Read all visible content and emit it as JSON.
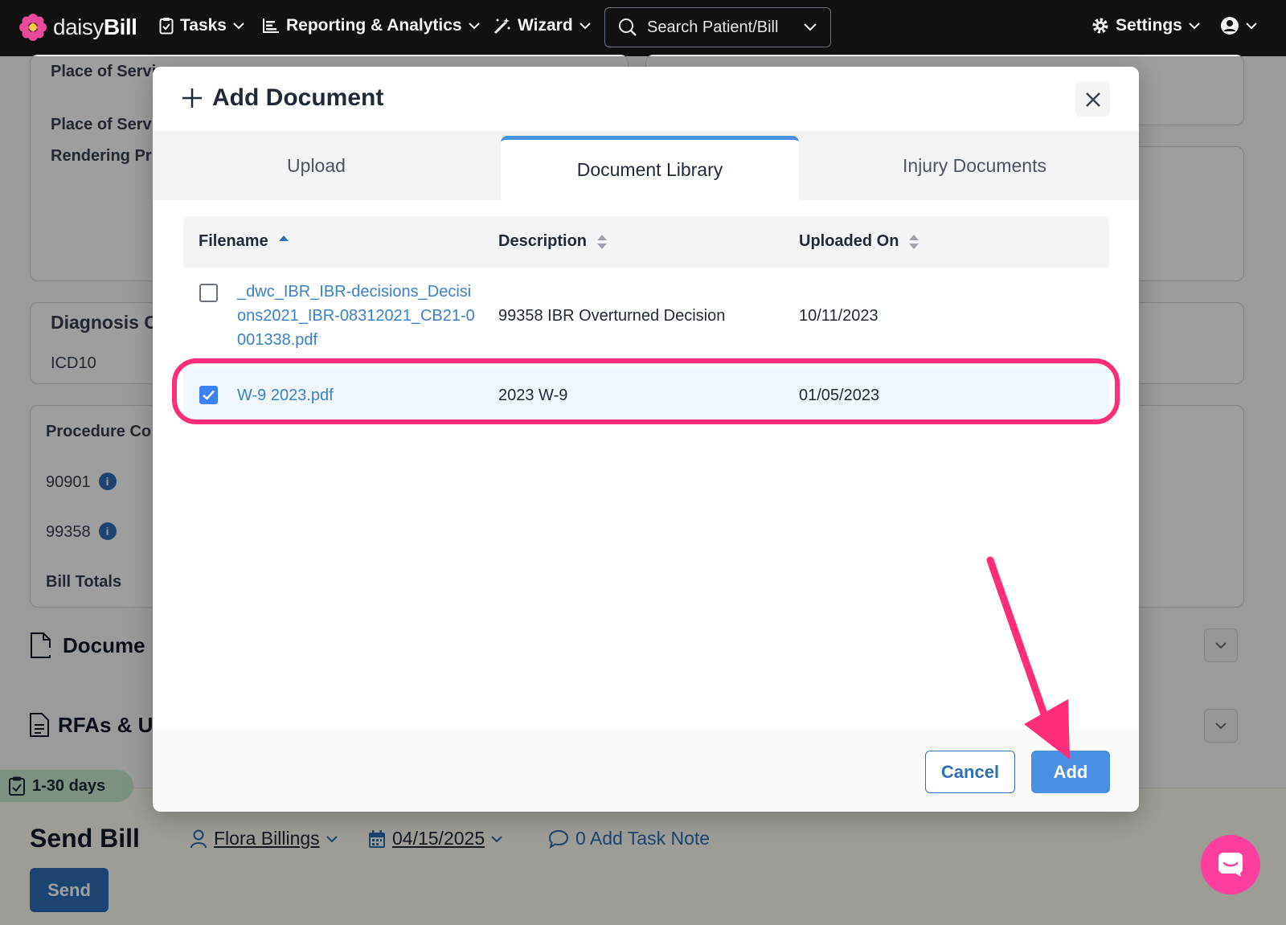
{
  "nav": {
    "brand_light": "daisy",
    "brand_bold": "Bill",
    "tasks": "Tasks",
    "reporting": "Reporting & Analytics",
    "wizard": "Wizard",
    "search_placeholder": "Search Patient/Bill",
    "settings": "Settings"
  },
  "background": {
    "place_of_service_1": "Place of Servi",
    "place_of_service_2": "Place of Servi",
    "rendering": "Rendering Pr",
    "diagnosis": "Diagnosis C",
    "icd10": "ICD10",
    "procedure": "Procedure Co",
    "proc_1": "90901",
    "proc_2": "99358",
    "bill_totals": "Bill Totals",
    "documents": "Docume",
    "rfas": "RFAs & U",
    "days": "1-30 days",
    "send_bill": "Send Bill",
    "assignee": "Flora Billings",
    "due_date": "04/15/2025",
    "task_note": "0 Add Task Note",
    "send_button": "Send"
  },
  "modal": {
    "title": "Add Document",
    "tabs": [
      {
        "label": "Upload",
        "active": false
      },
      {
        "label": "Document Library",
        "active": true
      },
      {
        "label": "Injury Documents",
        "active": false
      }
    ],
    "columns": {
      "filename": "Filename",
      "description": "Description",
      "uploaded_on": "Uploaded On"
    },
    "rows": [
      {
        "filename_lines": [
          "_dwc_IBR_IBR-decisions_Decisi",
          "ons2021_IBR-08312021_CB21-0",
          "001338.pdf"
        ],
        "description": "99358 IBR Overturned Decision",
        "uploaded_on": "10/11/2023",
        "checked": false
      },
      {
        "filename_lines": [
          "W-9 2023.pdf"
        ],
        "description": "2023 W-9",
        "uploaded_on": "01/05/2023",
        "checked": true
      }
    ],
    "cancel_label": "Cancel",
    "add_label": "Add"
  },
  "colors": {
    "accent": "#4a90e2",
    "annotation": "#ff2d7a",
    "nav_bg": "#111111"
  }
}
